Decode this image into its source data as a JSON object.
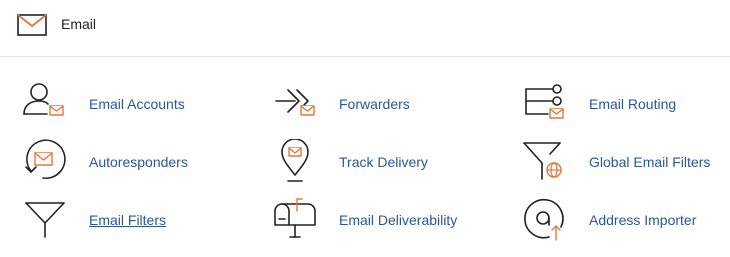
{
  "header": {
    "icon": "envelope-icon",
    "title": "Email"
  },
  "colors": {
    "link": "#2b5797",
    "accent": "#e8743b",
    "icon_stroke": "#222222",
    "divider": "#e4e4e4"
  },
  "items": [
    {
      "label": "Email Accounts",
      "icon": "user-mail-icon"
    },
    {
      "label": "Forwarders",
      "icon": "forward-arrows-icon"
    },
    {
      "label": "Email Routing",
      "icon": "routing-icon"
    },
    {
      "label": "Autoresponders",
      "icon": "autoresponder-icon"
    },
    {
      "label": "Track Delivery",
      "icon": "map-pin-mail-icon"
    },
    {
      "label": "Global Email Filters",
      "icon": "funnel-globe-icon"
    },
    {
      "label": "Email Filters",
      "icon": "funnel-icon"
    },
    {
      "label": "Email Deliverability",
      "icon": "mailbox-icon"
    },
    {
      "label": "Address Importer",
      "icon": "import-icon"
    }
  ]
}
